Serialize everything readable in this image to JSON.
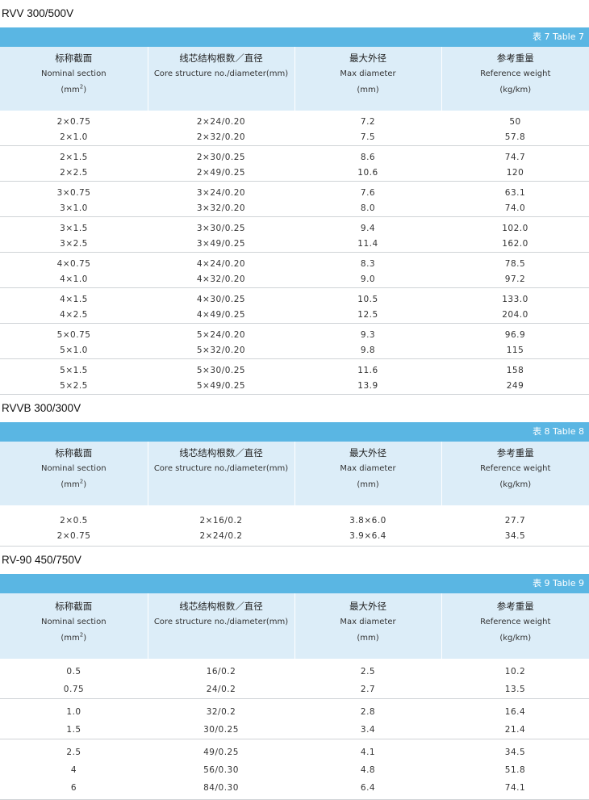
{
  "colors": {
    "band": "#5ab6e3",
    "header_bg": "#dcedf8",
    "row_border": "#cfd3d6"
  },
  "sections": [
    {
      "title": "RVV 300/500V",
      "table_label": "表 7  Table 7",
      "headers": [
        {
          "zh": "标称截面",
          "en": "Nominal section",
          "unit": "(mm",
          "sup": "2",
          "unit_end": ")"
        },
        {
          "zh": "线芯结构根数／直径",
          "en": "Core structure no./diameter(mm)",
          "unit": "",
          "sup": "",
          "unit_end": ""
        },
        {
          "zh": "最大外径",
          "en": "Max diameter",
          "unit": "(mm)",
          "sup": "",
          "unit_end": ""
        },
        {
          "zh": "参考重量",
          "en": "Reference weight",
          "unit": "(kg/km)",
          "sup": "",
          "unit_end": ""
        }
      ],
      "groups": [
        [
          [
            "2×0.75",
            "2×1.0"
          ],
          [
            "2×24/0.20",
            "2×32/0.20"
          ],
          [
            "7.2",
            "7.5"
          ],
          [
            "50",
            "57.8"
          ]
        ],
        [
          [
            "2×1.5",
            "2×2.5"
          ],
          [
            "2×30/0.25",
            "2×49/0.25"
          ],
          [
            "8.6",
            "10.6"
          ],
          [
            "74.7",
            "120"
          ]
        ],
        [
          [
            "3×0.75",
            "3×1.0"
          ],
          [
            "3×24/0.20",
            "3×32/0.20"
          ],
          [
            "7.6",
            "8.0"
          ],
          [
            "63.1",
            "74.0"
          ]
        ],
        [
          [
            "3×1.5",
            "3×2.5"
          ],
          [
            "3×30/0.25",
            "3×49/0.25"
          ],
          [
            "9.4",
            "11.4"
          ],
          [
            "102.0",
            "162.0"
          ]
        ],
        [
          [
            "4×0.75",
            "4×1.0"
          ],
          [
            "4×24/0.20",
            "4×32/0.20"
          ],
          [
            "8.3",
            "9.0"
          ],
          [
            "78.5",
            "97.2"
          ]
        ],
        [
          [
            "4×1.5",
            "4×2.5"
          ],
          [
            "4×30/0.25",
            "4×49/0.25"
          ],
          [
            "10.5",
            "12.5"
          ],
          [
            "133.0",
            "204.0"
          ]
        ],
        [
          [
            "5×0.75",
            "5×1.0"
          ],
          [
            "5×24/0.20",
            "5×32/0.20"
          ],
          [
            "9.3",
            "9.8"
          ],
          [
            "96.9",
            "115"
          ]
        ],
        [
          [
            "5×1.5",
            "5×2.5"
          ],
          [
            "5×30/0.25",
            "5×49/0.25"
          ],
          [
            "11.6",
            "13.9"
          ],
          [
            "158",
            "249"
          ]
        ]
      ]
    },
    {
      "title": "RVVB 300/300V",
      "table_label": "表 8  Table 8",
      "headers": [
        {
          "zh": "标称截面",
          "en": "Nominal section",
          "unit": "(mm",
          "sup": "2",
          "unit_end": ")"
        },
        {
          "zh": "线芯结构根数／直径",
          "en": "Core structure no./diameter(mm)",
          "unit": "",
          "sup": "",
          "unit_end": ""
        },
        {
          "zh": "最大外径",
          "en": "Max diameter",
          "unit": "(mm)",
          "sup": "",
          "unit_end": ""
        },
        {
          "zh": "参考重量",
          "en": "Reference weight",
          "unit": "(kg/km)",
          "sup": "",
          "unit_end": ""
        }
      ],
      "groups": [
        [
          [
            "2×0.5",
            "2×0.75"
          ],
          [
            "2×16/0.2",
            "2×24/0.2"
          ],
          [
            "3.8×6.0",
            "3.9×6.4"
          ],
          [
            "27.7",
            "34.5"
          ]
        ]
      ]
    },
    {
      "title": "RV-90 450/750V",
      "table_label": "表 9  Table 9",
      "headers": [
        {
          "zh": "标称截面",
          "en": "Nominal section",
          "unit": "(mm",
          "sup": "2",
          "unit_end": ")"
        },
        {
          "zh": "线芯结构根数／直径",
          "en": "Core structure no./diameter(mm)",
          "unit": "",
          "sup": "",
          "unit_end": ""
        },
        {
          "zh": "最大外径",
          "en": "Max diameter",
          "unit": "(mm)",
          "sup": "",
          "unit_end": ""
        },
        {
          "zh": "参考重量",
          "en": "Reference weight",
          "unit": "(kg/km)",
          "sup": "",
          "unit_end": ""
        }
      ],
      "groups": [
        [
          [
            "0.5",
            "0.75"
          ],
          [
            "16/0.2",
            "24/0.2"
          ],
          [
            "2.5",
            "2.7"
          ],
          [
            "10.2",
            "13.5"
          ]
        ],
        [
          [
            "1.0",
            "1.5"
          ],
          [
            "32/0.2",
            "30/0.25"
          ],
          [
            "2.8",
            "3.4"
          ],
          [
            "16.4",
            "21.4"
          ]
        ],
        [
          [
            "2.5",
            "4",
            "6"
          ],
          [
            "49/0.25",
            "56/0.30",
            "84/0.30"
          ],
          [
            "4.1",
            "4.8",
            "6.4"
          ],
          [
            "34.5",
            "51.8",
            "74.1"
          ]
        ]
      ]
    }
  ]
}
